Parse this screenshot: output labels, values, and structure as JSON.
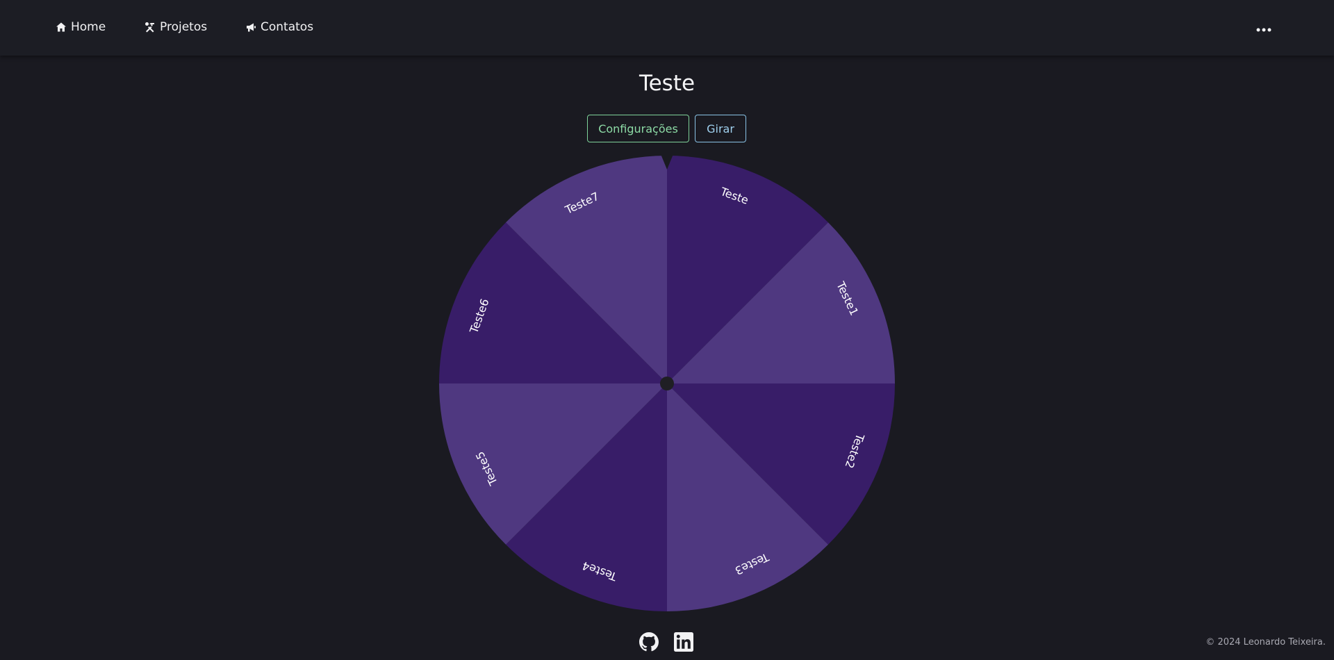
{
  "nav": {
    "home_label": "Home",
    "home_icon": "home-icon",
    "projetos_label": "Projetos",
    "projetos_icon": "tools-icon",
    "contatos_label": "Contatos",
    "contatos_icon": "megaphone-icon",
    "more_icon": "ellipsis-icon"
  },
  "page": {
    "title": "Teste"
  },
  "actions": {
    "config_label": "Configurações",
    "girar_label": "Girar"
  },
  "wheel": {
    "slices": [
      "Teste",
      "Teste1",
      "Teste2",
      "Teste3",
      "Teste4",
      "Teste5",
      "Teste6",
      "Teste7"
    ],
    "colors": [
      "#381d68",
      "#4f3880"
    ],
    "label_color": "#ffffff",
    "pointer_color": "#1a1a21",
    "hub_color": "#1f1f24"
  },
  "footer": {
    "github_icon": "github-icon",
    "linkedin_icon": "linkedin-icon",
    "copyright": "© 2024 Leonardo Teixeira."
  }
}
